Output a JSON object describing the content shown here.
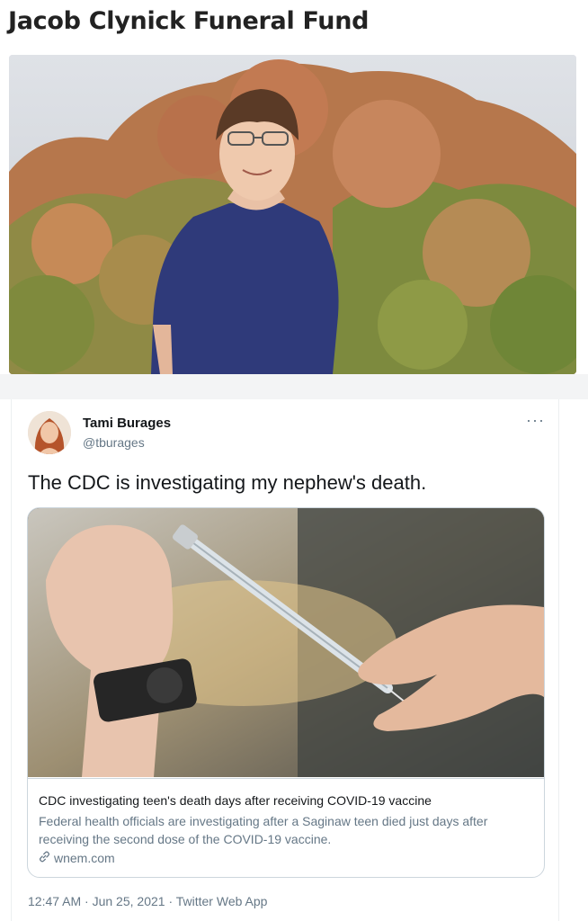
{
  "fundraiser": {
    "title": "Jacob Clynick Funeral Fund"
  },
  "tweet": {
    "display_name": "Tami Burages",
    "handle": "@tburages",
    "more_icon": "more-options-icon",
    "more_label": "···",
    "text": "The CDC is investigating my nephew's death.",
    "card": {
      "title": "CDC investigating teen's death days after receiving COVID-19 vaccine",
      "description": "Federal health officials are investigating after a Saginaw teen died just days after receiving the second dose of the COVID-19 vaccine.",
      "domain": "wnem.com",
      "domain_icon": "link-icon"
    },
    "timestamp": "12:47 AM · Jun 25, 2021 · Twitter Web App"
  }
}
